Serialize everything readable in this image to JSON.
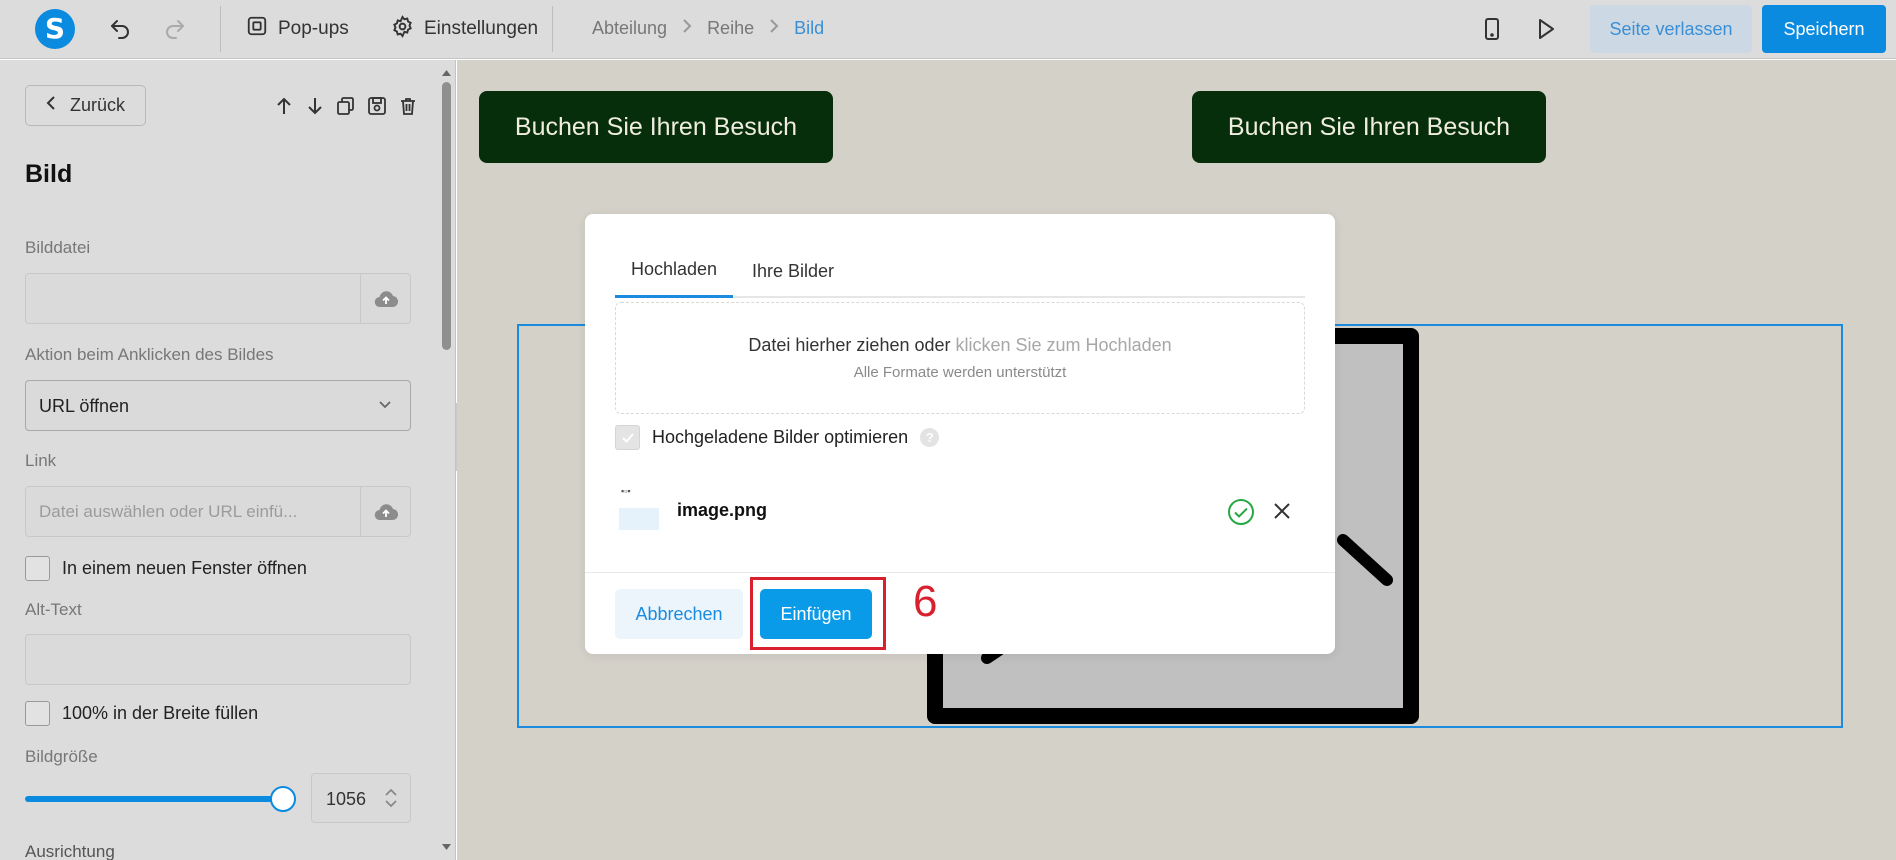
{
  "topbar": {
    "logo_letter": "S",
    "popups_label": "Pop-ups",
    "settings_label": "Einstellungen",
    "breadcrumb": [
      "Abteilung",
      "Reihe",
      "Bild"
    ],
    "leave_label": "Seite verlassen",
    "save_label": "Speichern"
  },
  "sidebar": {
    "back_label": "Zurück",
    "title": "Bild",
    "image_file_label": "Bilddatei",
    "click_action_label": "Aktion beim Anklicken des Bildes",
    "click_action_value": "URL öffnen",
    "link_label": "Link",
    "link_placeholder": "Datei auswählen oder URL einfü...",
    "new_window_label": "In einem neuen Fenster öffnen",
    "alt_label": "Alt-Text",
    "fill_width_label": "100% in der Breite füllen",
    "size_label": "Bildgröße",
    "size_value": "1056",
    "alignment_label": "Ausrichtung"
  },
  "canvas": {
    "cta_left": "Buchen Sie Ihren Besuch",
    "cta_right": "Buchen Sie Ihren Besuch"
  },
  "modal": {
    "tabs": [
      "Hochladen",
      "Ihre Bilder"
    ],
    "drop_text": "Datei hierher ziehen oder ",
    "drop_link": "klicken Sie zum Hochladen",
    "drop_sub": "Alle Formate werden unterstützt",
    "optimize_label": "Hochgeladene Bilder optimieren",
    "help_glyph": "?",
    "file_name": "image.png",
    "cancel_label": "Abbrechen",
    "insert_label": "Einfügen"
  },
  "annotation": {
    "step_number": "6"
  },
  "colors": {
    "accent": "#0a8be0",
    "cta_bg": "#062e0b",
    "annotation": "#d9202e",
    "success": "#27a844"
  }
}
